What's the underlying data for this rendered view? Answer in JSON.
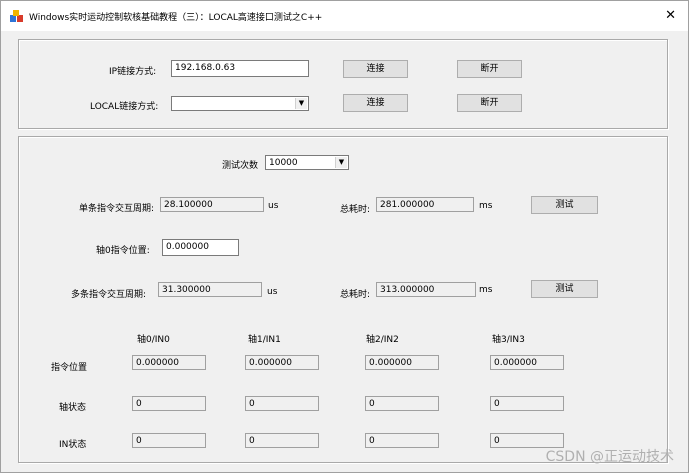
{
  "window": {
    "title": "Windows实时运动控制软核基础教程（三）：LOCAL高速接口测试之C++",
    "close_symbol": "✕"
  },
  "connection": {
    "ip_label": "IP链接方式:",
    "ip_value": "192.168.0.63",
    "ip_connect": "连接",
    "ip_disconnect": "断开",
    "local_label": "LOCAL链接方式:",
    "local_value": "",
    "local_connect": "连接",
    "local_disconnect": "断开"
  },
  "test": {
    "count_label": "测试次数",
    "count_value": "10000",
    "single_label": "单条指令交互周期:",
    "single_value": "28.100000",
    "single_unit": "us",
    "single_total_label": "总耗时:",
    "single_total_value": "281.000000",
    "single_total_unit": "ms",
    "single_test_button": "测试",
    "axis0_label": "轴0指令位置:",
    "axis0_value": "0.000000",
    "multi_label": "多条指令交互周期:",
    "multi_value": "31.300000",
    "multi_unit": "us",
    "multi_total_label": "总耗时:",
    "multi_total_value": "313.000000",
    "multi_total_unit": "ms",
    "multi_test_button": "测试"
  },
  "grid": {
    "headers": [
      "轴0/IN0",
      "轴1/IN1",
      "轴2/IN2",
      "轴3/IN3"
    ],
    "rows": [
      {
        "label": "指令位置",
        "values": [
          "0.000000",
          "0.000000",
          "0.000000",
          "0.000000"
        ]
      },
      {
        "label": "轴状态",
        "values": [
          "0",
          "0",
          "0",
          "0"
        ]
      },
      {
        "label": "IN状态",
        "values": [
          "0",
          "0",
          "0",
          "0"
        ]
      }
    ]
  },
  "watermark": "CSDN @正运动技术"
}
